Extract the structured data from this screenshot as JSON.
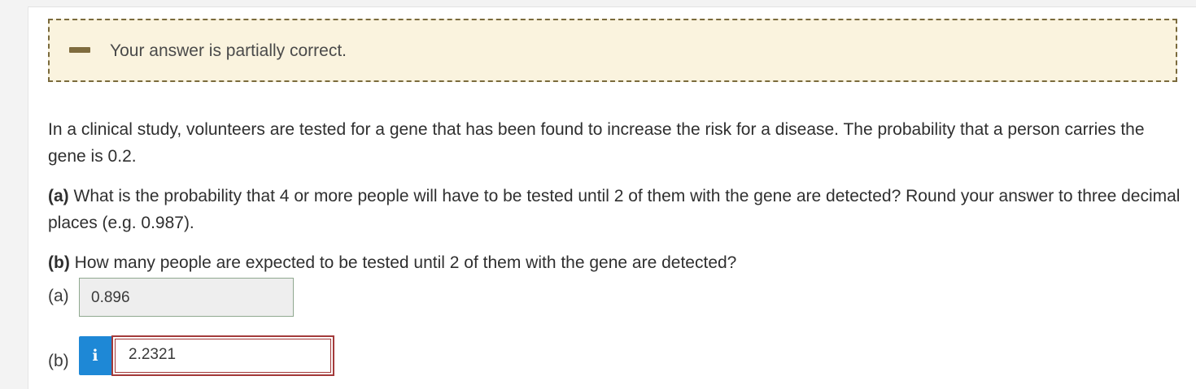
{
  "feedback": {
    "icon": "minus-icon",
    "icon_color": "#7f6c3e",
    "message": "Your answer is partially correct."
  },
  "question": {
    "intro": "In a clinical study, volunteers are tested for a gene that has been found to increase the risk for a disease. The probability that a person carries the gene is 0.2.",
    "part_a_label": "(a)",
    "part_a_text": "What is the probability that 4 or more people will have to be tested until 2 of them with the gene are detected? Round your answer to three decimal places (e.g. 0.987).",
    "part_b_label": "(b)",
    "part_b_text": "How many people are expected to be tested until 2 of them with the gene are detected?"
  },
  "answers": {
    "a": {
      "label": "(a)",
      "value": "0.896",
      "status": "correct"
    },
    "b": {
      "label": "(b)",
      "info_icon": "info-icon",
      "info_glyph": "i",
      "info_color": "#1e88d6",
      "value": "2.2321",
      "status": "incorrect",
      "status_color": "#a33a3a"
    }
  }
}
